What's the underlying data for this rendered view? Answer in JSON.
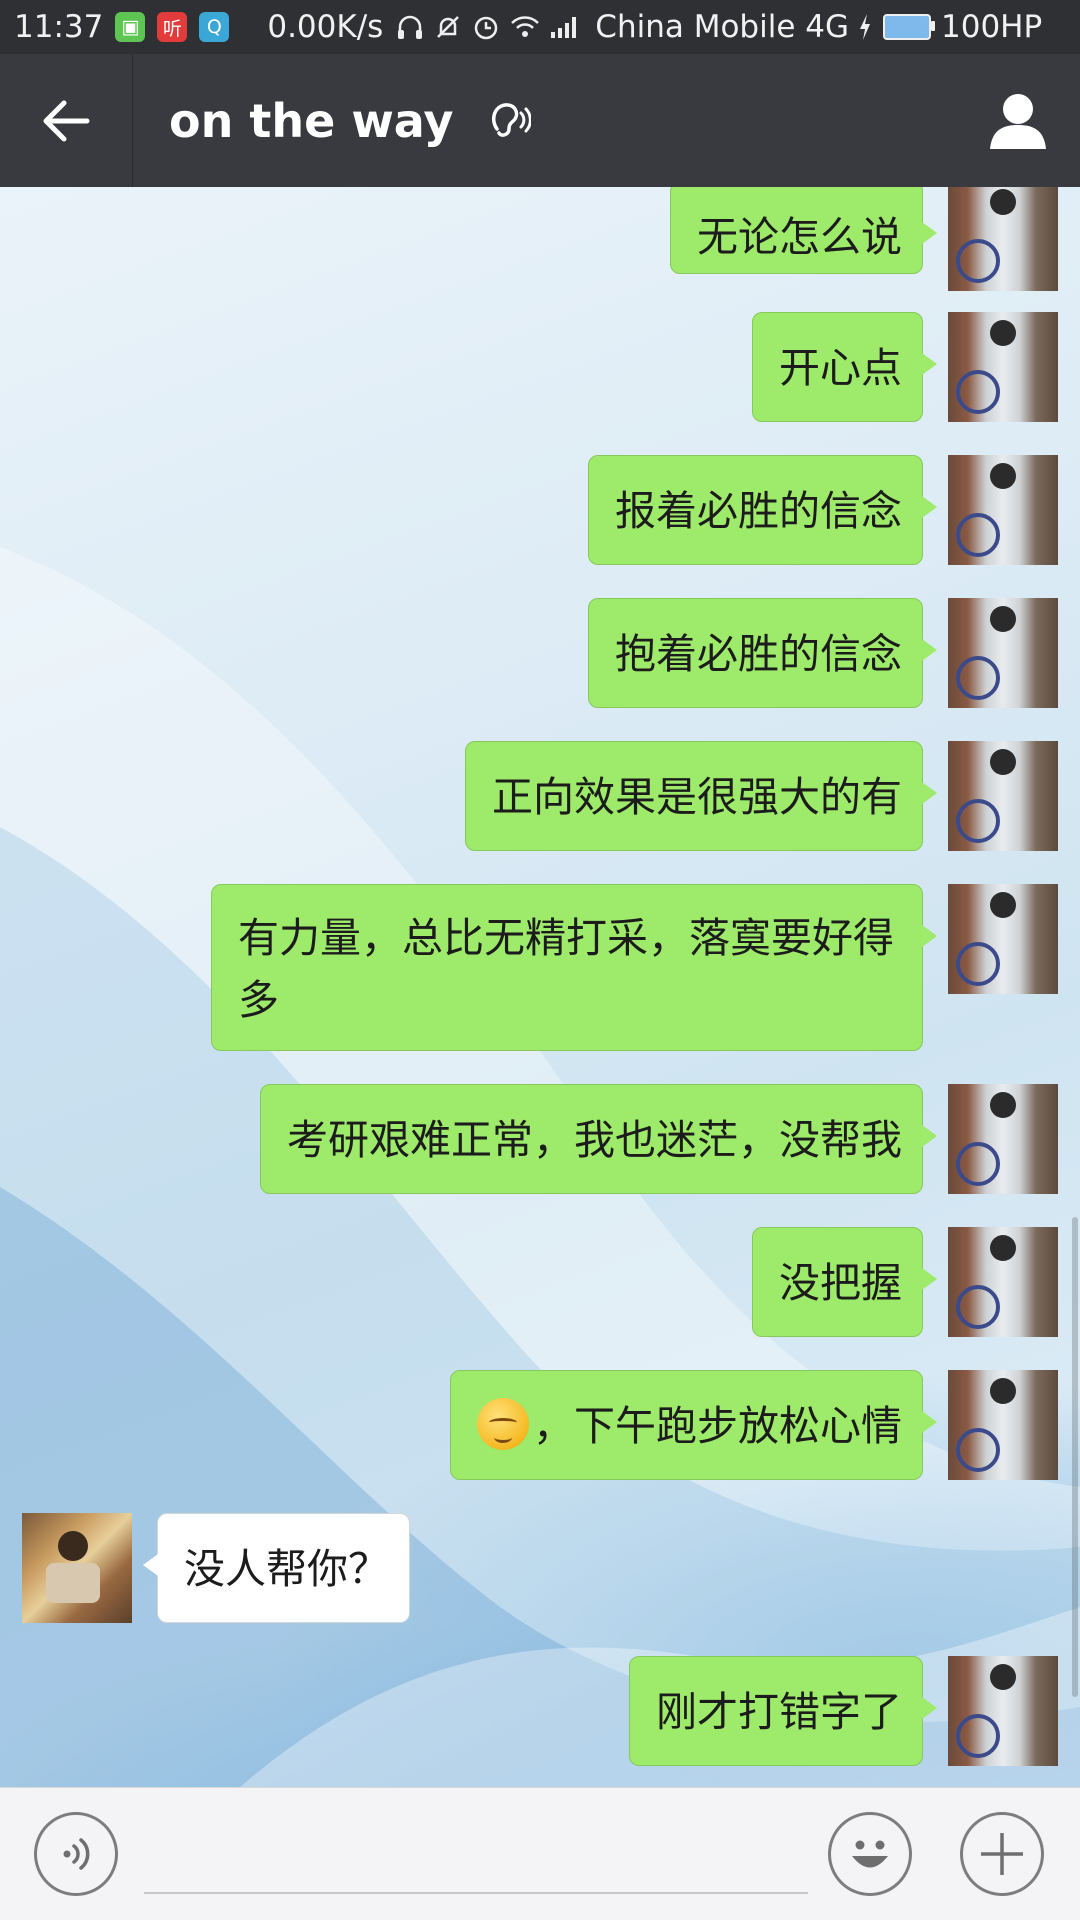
{
  "status_bar": {
    "time": "11:37",
    "app_icons": [
      {
        "name": "green-app-icon",
        "glyph": "▣"
      },
      {
        "name": "ting-app-icon",
        "glyph": "听"
      },
      {
        "name": "q-app-icon",
        "glyph": "Q"
      }
    ],
    "net_speed": "0.00K/s",
    "carrier": "China Mobile 4G",
    "battery": "100HP"
  },
  "header": {
    "title": "on the way"
  },
  "messages": [
    {
      "side": "self",
      "text": "无论怎么说"
    },
    {
      "side": "self",
      "text": "开心点"
    },
    {
      "side": "self",
      "text": "报着必胜的信念"
    },
    {
      "side": "self",
      "text": "抱着必胜的信念"
    },
    {
      "side": "self",
      "text": "正向效果是很强大的有"
    },
    {
      "side": "self",
      "text": "有力量，总比无精打采，落寞要好得多"
    },
    {
      "side": "self",
      "text": "考研艰难正常，我也迷茫，没帮我"
    },
    {
      "side": "self",
      "text": "没把握"
    },
    {
      "side": "self",
      "text": "，下午跑步放松心情",
      "emoji": "blushing-face"
    },
    {
      "side": "other",
      "text": "没人帮你？"
    },
    {
      "side": "self",
      "text": "刚才打错字了"
    }
  ],
  "input": {
    "value": "",
    "placeholder": ""
  },
  "colors": {
    "self_bubble": "#9eea6a",
    "other_bubble": "#ffffff",
    "header_bg": "#393a3f",
    "statusbar_bg": "#2e3033"
  }
}
